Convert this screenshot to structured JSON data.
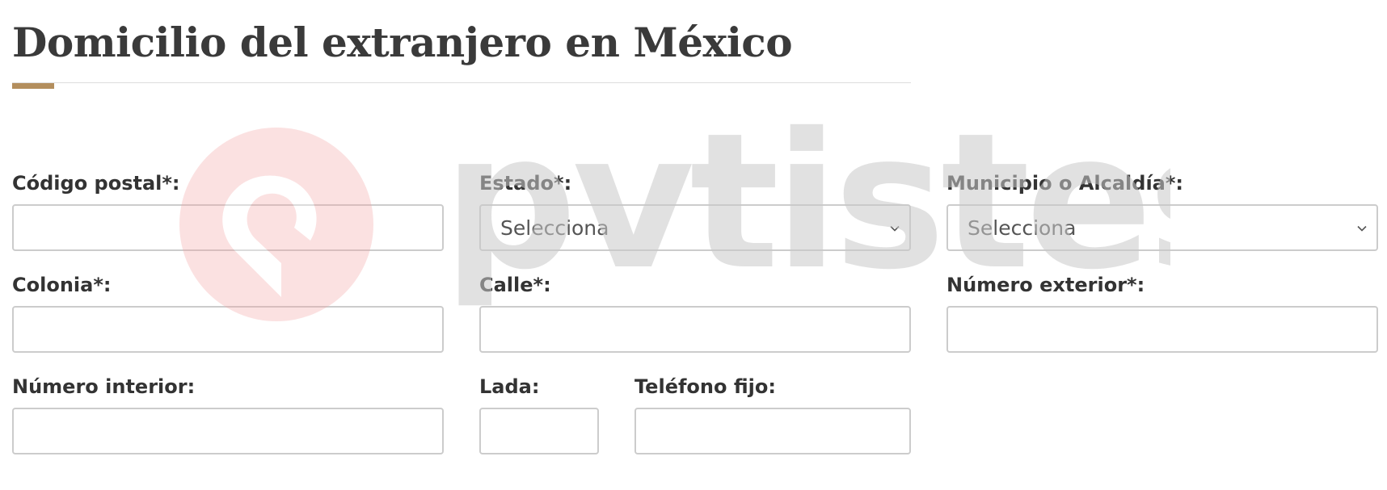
{
  "section": {
    "title": "Domicilio del extranjero en México"
  },
  "form": {
    "codigo_postal": {
      "label": "Código postal*:",
      "value": "",
      "placeholder": ""
    },
    "estado": {
      "label": "Estado*:",
      "selected": "Selecciona"
    },
    "municipio": {
      "label": "Municipio o Alcaldía*:",
      "selected": "Selecciona"
    },
    "colonia": {
      "label": "Colonia*:",
      "value": "",
      "placeholder": ""
    },
    "calle": {
      "label": "Calle*:",
      "value": "",
      "placeholder": ""
    },
    "numero_exterior": {
      "label": "Número exterior*:",
      "value": "",
      "placeholder": ""
    },
    "numero_interior": {
      "label": "Número interior:",
      "value": "",
      "placeholder": ""
    },
    "lada": {
      "label": "Lada:",
      "value": "",
      "placeholder": ""
    },
    "telefono_fijo": {
      "label": "Teléfono fijo:",
      "value": "",
      "placeholder": ""
    }
  },
  "watermark": {
    "text": "pvtistes",
    "icon": "location-pin-icon"
  },
  "colors": {
    "accent": "#b38e5d",
    "text": "#333333",
    "border": "#cccccc",
    "rule": "#dddddd",
    "watermark_text": "#c8c8c8",
    "watermark_logo": "#f4a3a3"
  }
}
